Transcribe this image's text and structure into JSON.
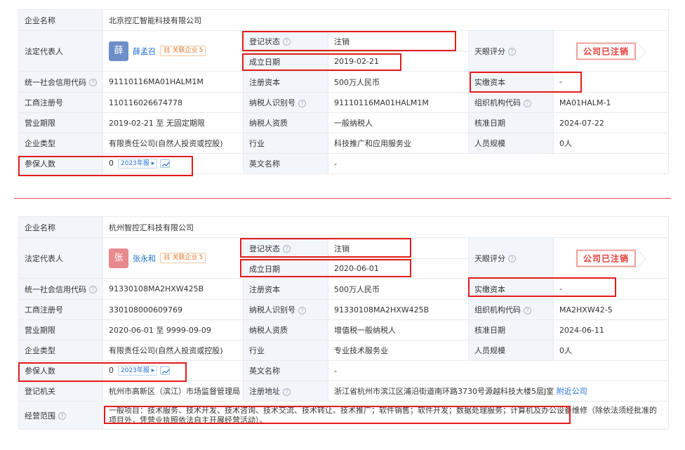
{
  "labels": {
    "company_name": "企业名称",
    "legal_rep": "法定代表人",
    "reg_status": "登记状态",
    "found_date": "成立日期",
    "tianyan": "天眼评分",
    "credit_code": "统一社会信用代码",
    "reg_capital": "注册资本",
    "paid_capital": "实缴资本",
    "biz_reg_no": "工商注册号",
    "tax_id": "纳税人识别号",
    "org_code": "组织机构代码",
    "biz_term": "营业期限",
    "taxpayer_type": "纳税人资质",
    "approve_date": "核准日期",
    "company_type": "企业类型",
    "industry": "行业",
    "staff_size": "人员规模",
    "insured": "参保人数",
    "english_name": "英文名称",
    "reg_authority": "登记机关",
    "reg_address": "注册地址",
    "biz_scope": "经营范围",
    "related_company": "关联企业",
    "year_report": "2023年报",
    "nearby": "附近公司"
  },
  "company1": {
    "name": "北京控汇智能科技有限公司",
    "avatar_char": "薛",
    "avatar_color": "#6d8fc7",
    "person": "薛孟召",
    "related_count": "5",
    "status": "注销",
    "found_date": "2019-02-21",
    "stamp": "公司已注销",
    "credit_code": "91110116MA01HALM1M",
    "reg_capital": "500万人民币",
    "paid_capital": "-",
    "biz_reg_no": "110116026674778",
    "tax_id": "91110116MA01HALM1M",
    "org_code": "MA01HALM-1",
    "biz_term": "2019-02-21 至 无固定期限",
    "taxpayer_type": "一般纳税人",
    "approve_date": "2024-07-22",
    "company_type": "有限责任公司(自然人投资或控股)",
    "industry": "科技推广和应用服务业",
    "staff_size": "0人",
    "insured": "0",
    "english_name": "-"
  },
  "company2": {
    "name": "杭州智控汇科技有限公司",
    "avatar_char": "张",
    "avatar_color": "#e7898d",
    "person": "张永和",
    "related_count": "5",
    "status": "注销",
    "found_date": "2020-06-01",
    "stamp": "公司已注销",
    "credit_code": "91330108MA2HXW425B",
    "reg_capital": "500万人民币",
    "paid_capital": "-",
    "biz_reg_no": "330108000609769",
    "tax_id": "91330108MA2HXW425B",
    "org_code": "MA2HXW42-5",
    "biz_term": "2020-06-01 至 9999-09-09",
    "taxpayer_type": "增值税一般纳税人",
    "approve_date": "2024-06-11",
    "company_type": "有限责任公司(自然人投资或控股)",
    "industry": "专业技术服务业",
    "staff_size": "0人",
    "insured": "0",
    "english_name": "-",
    "reg_authority": "杭州市高新区（滨江）市场监督管理局",
    "reg_address": "浙江省杭州市滨江区浦沿街道南环路3730号源越科技大楼5层J室",
    "biz_scope": "一般项目：技术服务、技术开发、技术咨询、技术交流、技术转让、技术推广；软件销售；软件开发；数据处理服务；计算机及办公设备维修（除依法须经批准的项目外，凭营业执照依法自主开展经营活动）。"
  },
  "colors": {
    "label_bg": "#f2f6fb",
    "border": "#e6ebf0",
    "status_red": "#e53935",
    "link_blue": "#1e6fd6",
    "highlight_red": "#e31b1b"
  }
}
